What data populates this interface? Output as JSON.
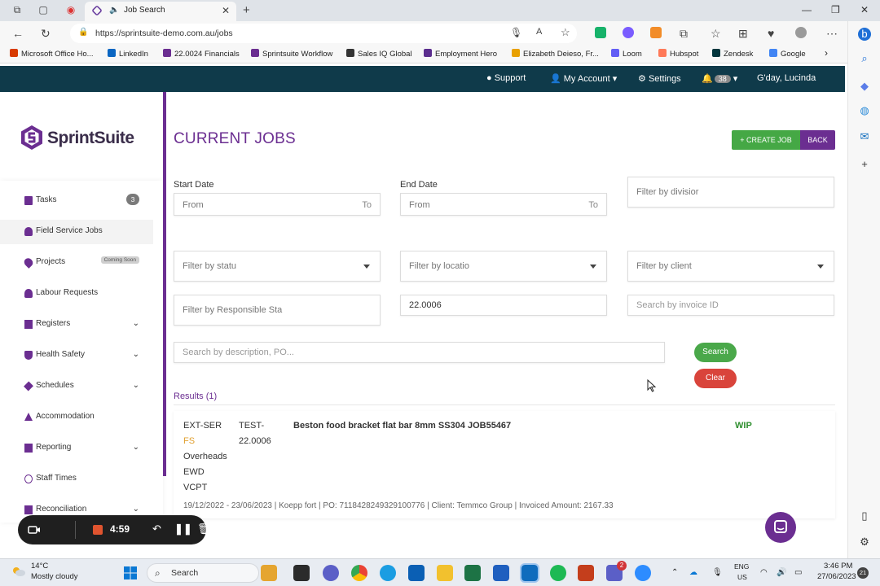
{
  "browser": {
    "tab_title": "Job Search",
    "url": "https://sprintsuite-demo.com.au/jobs",
    "bookmarks": [
      {
        "label": "Microsoft Office Ho...",
        "color": "#d83b01"
      },
      {
        "label": "LinkedIn",
        "color": "#0a66c2"
      },
      {
        "label": "22.0024 Financials",
        "color": "#6b2e91"
      },
      {
        "label": "Sprintsuite Workflow",
        "color": "#6b2e91"
      },
      {
        "label": "Sales IQ Global",
        "color": "#333333"
      },
      {
        "label": "Employment Hero",
        "color": "#5b2d8e"
      },
      {
        "label": "Elizabeth Deieso, Fr...",
        "color": "#e8a000"
      },
      {
        "label": "Loom",
        "color": "#625df5"
      },
      {
        "label": "Hubspot",
        "color": "#ff7a59"
      },
      {
        "label": "Zendesk",
        "color": "#03363d"
      },
      {
        "label": "Google",
        "color": "#4285f4"
      }
    ]
  },
  "header": {
    "support": "Support",
    "my_account": "My Account",
    "settings": "Settings",
    "notifications_count": "38",
    "greeting": "G'day, Lucinda"
  },
  "brand": {
    "name": "SprintSuite",
    "primary_color": "#6b2e91",
    "header_color": "#0f3a4a"
  },
  "sidebar": {
    "items": [
      {
        "label": "Tasks",
        "icon": "clipboard-icon",
        "badge": "3"
      },
      {
        "label": "Field Service Jobs",
        "icon": "person-icon"
      },
      {
        "label": "Projects",
        "icon": "pin-icon",
        "tag": "Coming Soon"
      },
      {
        "label": "Labour Requests",
        "icon": "user-icon"
      },
      {
        "label": "Registers",
        "icon": "book-icon"
      },
      {
        "label": "Health Safety",
        "icon": "shield-icon"
      },
      {
        "label": "Schedules",
        "icon": "layers-icon"
      },
      {
        "label": "Accommodation",
        "icon": "home-icon"
      },
      {
        "label": "Reporting",
        "icon": "report-icon"
      },
      {
        "label": "Staff Times",
        "icon": "clock-icon"
      },
      {
        "label": "Reconciliation",
        "icon": "bolt-icon"
      }
    ]
  },
  "main": {
    "title": "CURRENT JOBS",
    "create_job": "+ CREATE JOB",
    "back": "BACK",
    "start_date_label": "Start Date",
    "end_date_label": "End Date",
    "date_from": "From",
    "date_to": "To",
    "filter_division": "Filter by divisior",
    "filter_status": "Filter by statu",
    "filter_location": "Filter by locatio",
    "filter_client": "Filter by client",
    "filter_responsible": "Filter by Responsible Sta",
    "job_number_value": "22.0006",
    "search_invoice": "Search by invoice ID",
    "search_description": "Search by description, PO...",
    "search_button": "Search",
    "clear_button": "Clear",
    "results_label": "Results (1)"
  },
  "result": {
    "codes": [
      "EXT-SER",
      "FS",
      "Overheads",
      "EWD",
      "VCPT"
    ],
    "job_prefix": "TEST-",
    "job_number": "22.0006",
    "description": "Beston food bracket flat bar 8mm SS304 JOB55467",
    "status": "WIP",
    "meta": "19/12/2022 - 23/06/2023 | Koepp fort | PO: 7118428249329100776 | Client: Temmco Group | Invoiced Amount: 2167.33"
  },
  "recorder": {
    "timer": "4:59"
  },
  "taskbar": {
    "temperature": "14°C",
    "weather": "Mostly cloudy",
    "search": "Search",
    "lang_top": "ENG",
    "lang_bottom": "US",
    "time": "3:46 PM",
    "date": "27/06/2023",
    "notif_count": "21",
    "teams_badge": "2"
  }
}
